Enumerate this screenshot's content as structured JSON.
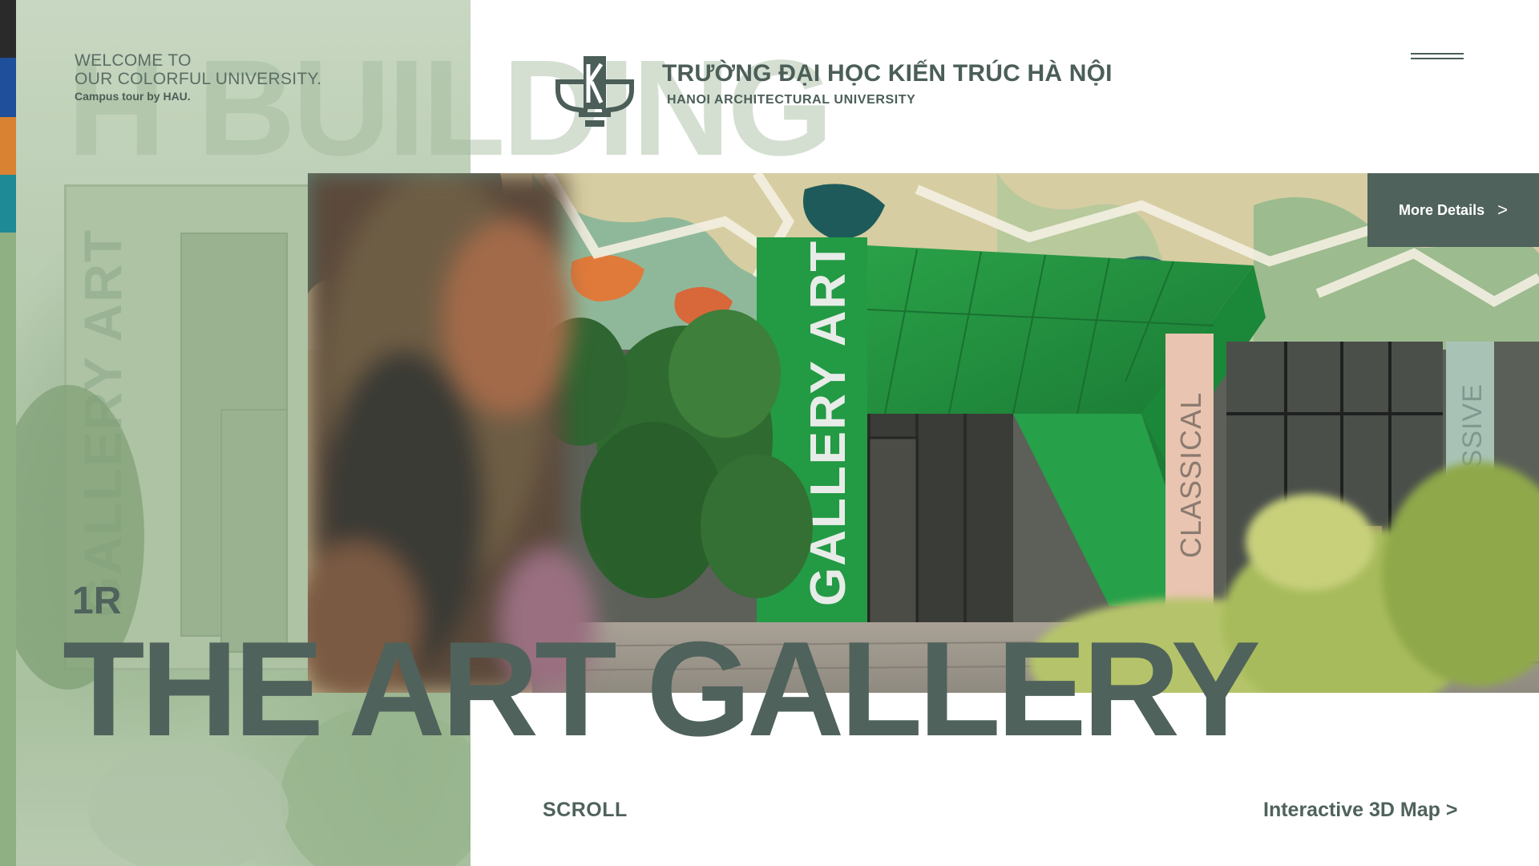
{
  "welcome": {
    "line1": "WELCOME TO",
    "line2": "OUR COLORFUL UNIVERSITY.",
    "tagline": "Campus tour by HAU."
  },
  "background_word": "H BUILDING",
  "header": {
    "school_name": "TRƯỜNG ĐẠI HỌC KIẾN TRÚC HÀ NỘI",
    "school_name_en": "HANOI ARCHITECTURAL UNIVERSITY",
    "logo_icon": "hau-logo-icon",
    "menu_icon": "hamburger-menu-icon"
  },
  "photo": {
    "signs": {
      "main": "GALLERY ART",
      "classical": "CLASSICAL",
      "impressive": "IMPRESSIVE"
    },
    "left_panel_sign": "GALLERY ART"
  },
  "more_details": {
    "label": "More Details",
    "arrow": ">"
  },
  "location": {
    "code": "1R",
    "title": "THE ART GALLERY"
  },
  "footer": {
    "scroll_label": "SCROLL",
    "map_link": "Interactive 3D Map >"
  },
  "colors": {
    "accent": "#4f625b",
    "strip": [
      "#2a2a2a",
      "#1f4e9a",
      "#d98232",
      "#1e8a95",
      "#8fb083"
    ],
    "facade_green": "#1f8c3a"
  }
}
